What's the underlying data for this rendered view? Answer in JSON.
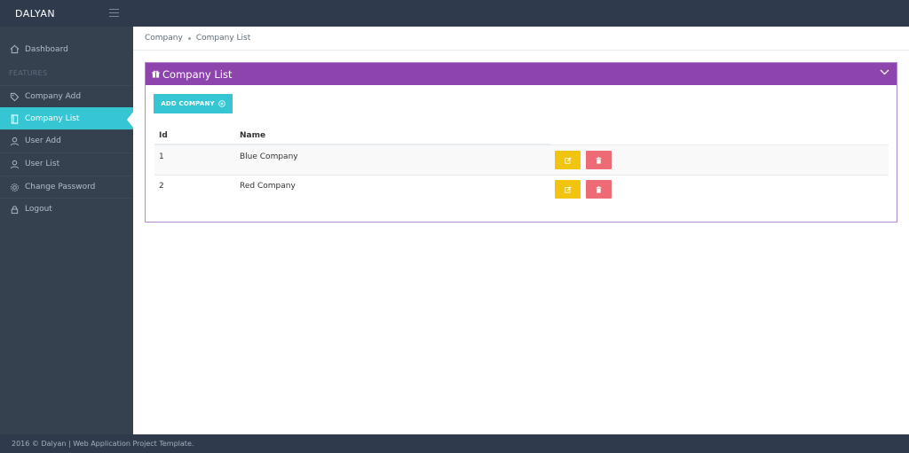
{
  "header": {
    "brand": "DALYAN"
  },
  "sidebar": {
    "dashboard": "Dashboard",
    "section_heading": "FEATURES",
    "items": [
      {
        "label": "Company Add"
      },
      {
        "label": "Company List"
      },
      {
        "label": "User Add"
      },
      {
        "label": "User List"
      },
      {
        "label": "Change Password"
      },
      {
        "label": "Logout"
      }
    ]
  },
  "breadcrumb": {
    "items": [
      "Company",
      "Company List"
    ]
  },
  "portlet": {
    "title": "Company List",
    "add_button": "ADD COMPANY",
    "columns": [
      "Id",
      "Name"
    ],
    "rows": [
      {
        "id": "1",
        "name": "Blue Company"
      },
      {
        "id": "2",
        "name": "Red Company"
      }
    ]
  },
  "footer": {
    "text": "2016 © Dalyan | Web Application Project Template."
  },
  "colors": {
    "topbar": "#2f3b4c",
    "sidebar": "#364150",
    "accent": "#36c6d3",
    "portlet_header": "#8e44ad",
    "edit_button": "#f1c40f",
    "delete_button": "#ed6b75"
  }
}
